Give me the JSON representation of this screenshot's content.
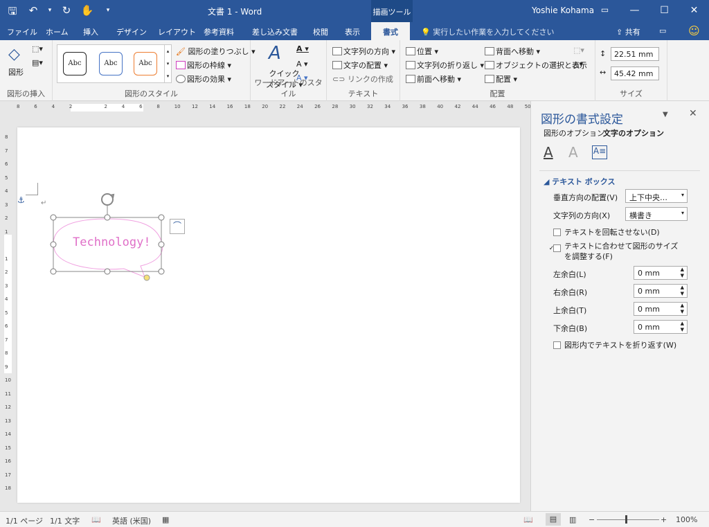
{
  "window": {
    "title": "文書 1 - Word",
    "context_tab": "描画ツール",
    "user": "Yoshie Kohama",
    "min": "—",
    "restore": "⧉",
    "max": "☐",
    "close": "✕"
  },
  "qat": {
    "save": "🖫",
    "undo": "↶",
    "undo_arrow": "▾",
    "redo": "↻",
    "touch": "✋",
    "customize": "▾"
  },
  "tabs": [
    "ファイル",
    "ホーム",
    "挿入",
    "デザイン",
    "レイアウト",
    "参考資料",
    "差し込み文書",
    "校閲",
    "表示"
  ],
  "active_tab": "書式",
  "tell_me": "実行したい作業を入力してください",
  "share": "共有",
  "ribbon": {
    "insert_shapes": {
      "label": "図形の挿入",
      "shapes": "図形"
    },
    "shape_styles": {
      "label": "図形のスタイル",
      "style_text": "Abc",
      "fill": "図形の塗りつぶし",
      "outline": "図形の枠線",
      "effects": "図形の効果"
    },
    "wordart": {
      "label": "ワードアートのスタイル",
      "quick1": "クイック",
      "quick2": "スタイル"
    },
    "text": {
      "label": "テキスト",
      "direction": "文字列の方向",
      "align": "文字の配置",
      "link": "リンクの作成"
    },
    "arrange": {
      "label": "配置",
      "position": "位置",
      "wrap": "文字列の折り返し",
      "forward": "前面へ移動",
      "backward": "背面へ移動",
      "selection": "オブジェクトの選択と表示",
      "align": "配置"
    },
    "size": {
      "label": "サイズ",
      "height": "22.51 mm",
      "width": "45.42 mm"
    }
  },
  "ruler_h": [
    "8",
    "6",
    "4",
    "2",
    "",
    "2",
    "4",
    "6",
    "8",
    "10",
    "12",
    "14",
    "16",
    "18",
    "20",
    "22",
    "24",
    "26",
    "28",
    "30",
    "32",
    "34",
    "36",
    "38",
    "40",
    "42",
    "44",
    "46",
    "48",
    "50"
  ],
  "ruler_v": [
    "8",
    "7",
    "6",
    "5",
    "4",
    "3",
    "2",
    "1",
    "",
    "1",
    "2",
    "3",
    "4",
    "5",
    "6",
    "7",
    "8",
    "9",
    "10",
    "11",
    "12",
    "13",
    "14",
    "15",
    "16",
    "17",
    "18"
  ],
  "document": {
    "shape_text": "Technology!",
    "para_mark": "↵"
  },
  "pane": {
    "title": "図形の書式設定",
    "tab_shape": "図形のオプション",
    "tab_text": "文字のオプション",
    "section": "テキスト ボックス",
    "valign_label": "垂直方向の配置(V)",
    "valign_value": "上下中央…",
    "dir_label": "文字列の方向(X)",
    "dir_value": "横書き",
    "no_rotate": "テキストを回転させない(D)",
    "autofit": "テキストに合わせて図形のサイズを調整する(F)",
    "left": "左余白(L)",
    "right": "右余白(R)",
    "top": "上余白(T)",
    "bottom": "下余白(B)",
    "margin_value": "0 mm",
    "wrap": "図形内でテキストを折り返す(W)"
  },
  "status": {
    "page": "1/1 ページ",
    "words": "1/1 文字",
    "lang": "英語 (米国)",
    "zoom": "100%"
  }
}
